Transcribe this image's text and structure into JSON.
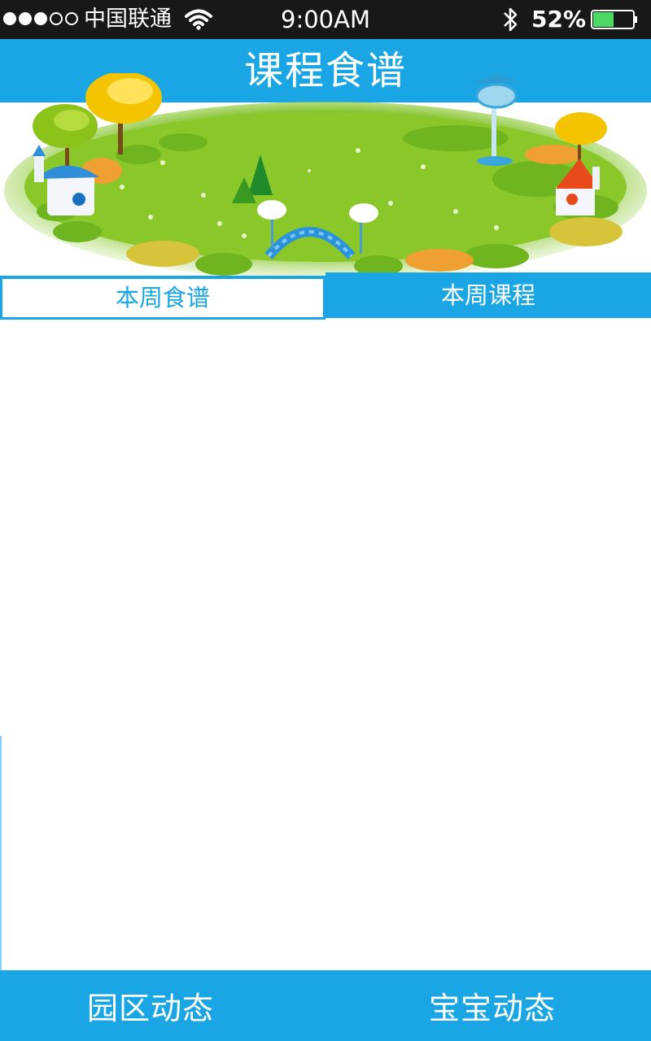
{
  "status_bar": {
    "signal_dots": 5,
    "signal_filled": 3,
    "carrier": "中国联通",
    "time": "9:00AM",
    "battery_pct": "52%",
    "battery_level": 0.52
  },
  "header": {
    "title": "课程食谱"
  },
  "tabs": [
    {
      "label": "本周食谱",
      "selected": true
    },
    {
      "label": "本周课程",
      "selected": false
    }
  ],
  "bottom_nav": [
    {
      "label": "园区动态"
    },
    {
      "label": "宝宝动态"
    }
  ],
  "colors": {
    "accent": "#1aa6e4",
    "status_bar": "#181818",
    "battery": "#4cd964"
  }
}
